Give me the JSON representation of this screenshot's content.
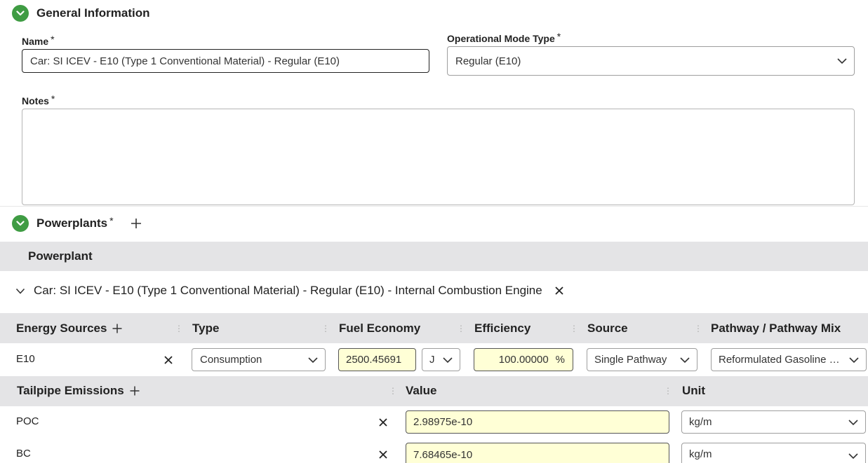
{
  "general": {
    "title": "General Information",
    "name_label": "Name",
    "name_value": "Car: SI ICEV - E10 (Type 1 Conventional Material) - Regular (E10)",
    "opmode_label": "Operational Mode Type",
    "opmode_value": "Regular (E10)",
    "notes_label": "Notes",
    "required_mark": "*"
  },
  "powerplants": {
    "title": "Powerplants",
    "table_header": "Powerplant",
    "row_label": "Car: SI ICEV - E10 (Type 1 Conventional Material) - Regular (E10) - Internal Combustion Engine"
  },
  "energy_sources": {
    "headers": {
      "energy": "Energy Sources",
      "type": "Type",
      "fuel_economy": "Fuel Economy",
      "efficiency": "Efficiency",
      "source": "Source",
      "pathway": "Pathway / Pathway Mix"
    },
    "row": {
      "name": "E10",
      "type": "Consumption",
      "fuel_economy": "2500.45691",
      "fuel_unit": "J",
      "efficiency": "100.00000",
      "efficiency_unit": "%",
      "source": "Single Pathway",
      "pathway": "Reformulated Gasoline (…"
    }
  },
  "tailpipe": {
    "headers": {
      "name": "Tailpipe Emissions",
      "value": "Value",
      "unit": "Unit"
    },
    "rows": [
      {
        "name": "POC",
        "value": "2.98975e-10",
        "unit": "kg/m"
      },
      {
        "name": "BC",
        "value": "7.68465e-10",
        "unit": "kg/m"
      }
    ]
  },
  "colors": {
    "accent_green": "#3f9c43",
    "band_grey": "#e4e4e6",
    "yellow_input": "#ffffd6"
  },
  "icons": [
    "chevron-down-icon",
    "plus-icon",
    "close-icon",
    "dropdown-caret-icon",
    "column-grip-icon"
  ]
}
